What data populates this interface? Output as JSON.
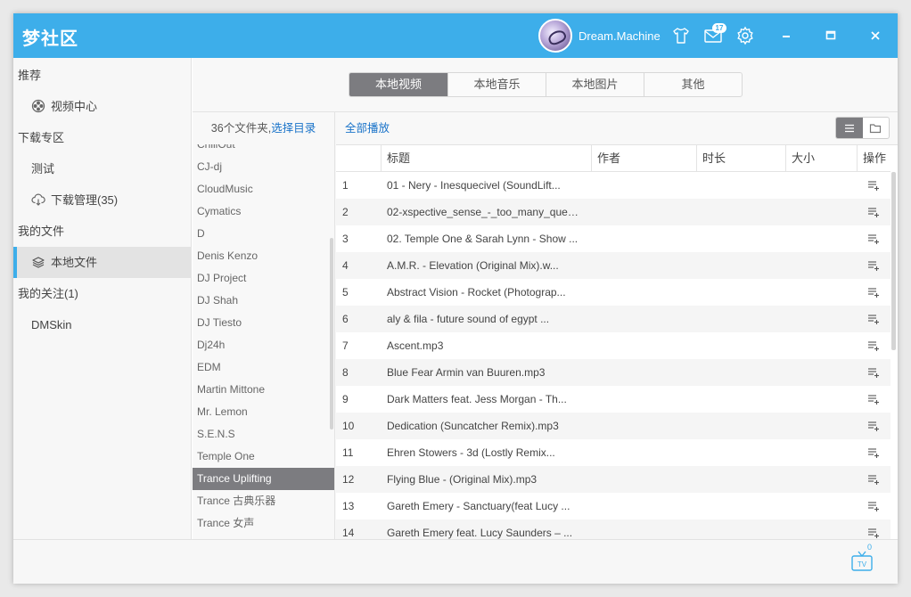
{
  "colors": {
    "accent": "#3daeea",
    "active_gray": "#7c7c80",
    "link": "#1a73c9"
  },
  "titlebar": {
    "app_title": "梦社区",
    "username": "Dream.Machine",
    "mail_badge": "17",
    "icons": [
      "shirt-icon",
      "mail-icon",
      "gear-icon",
      "minimize-icon",
      "maximize-icon",
      "close-icon"
    ]
  },
  "sidebar": {
    "recommend": "推荐",
    "video_center": "视频中心",
    "download_zone": "下载专区",
    "test": "测试",
    "download_manage": "下载管理(35)",
    "my_files": "我的文件",
    "local_files": "本地文件",
    "my_follow": "我的关注(1)",
    "dmskin": "DMSkin"
  },
  "tabs": [
    "本地视频",
    "本地音乐",
    "本地图片",
    "其他"
  ],
  "folders": {
    "count_text": "36个文件夹,",
    "choose_dir": "选择目录",
    "items": [
      "ChillOut",
      "CJ-dj",
      "CloudMusic",
      "Cymatics",
      "D",
      "Denis Kenzo",
      "DJ Project",
      "DJ Shah",
      "DJ Tiesto",
      "Dj24h",
      "EDM",
      "Martin Mittone",
      "Mr. Lemon",
      "S.E.N.S",
      "Temple One",
      "Trance Uplifting",
      "Trance 古典乐器",
      "Trance 女声"
    ],
    "selected": "Trance Uplifting"
  },
  "play_all": "全部播放",
  "table": {
    "headers": {
      "title": "标题",
      "author": "作者",
      "duration": "时长",
      "size": "大小",
      "action": "操作"
    },
    "rows": [
      {
        "n": "1",
        "title": "01 - Nery - Inesquecivel (SoundLift..."
      },
      {
        "n": "2",
        "title": "02-xspective_sense_-_too_many_quest..."
      },
      {
        "n": "3",
        "title": "02. Temple One & Sarah Lynn - Show ..."
      },
      {
        "n": "4",
        "title": "A.M.R. - Elevation (Original Mix).w..."
      },
      {
        "n": "5",
        "title": "Abstract Vision - Rocket (Photograp..."
      },
      {
        "n": "6",
        "title": "aly & fila - future sound of egypt ..."
      },
      {
        "n": "7",
        "title": "Ascent.mp3"
      },
      {
        "n": "8",
        "title": "Blue Fear Armin van Buuren.mp3"
      },
      {
        "n": "9",
        "title": "Dark Matters feat. Jess Morgan - Th..."
      },
      {
        "n": "10",
        "title": "Dedication (Suncatcher Remix).mp3"
      },
      {
        "n": "11",
        "title": "Ehren  Stowers - 3d  (Lostly  Remix..."
      },
      {
        "n": "12",
        "title": "Flying Blue -  (Original Mix).mp3"
      },
      {
        "n": "13",
        "title": "Gareth Emery - Sanctuary(feat Lucy ..."
      },
      {
        "n": "14",
        "title": "Gareth Emery feat. Lucy Saunders – ..."
      }
    ]
  },
  "footer": {
    "tv_label": "TV",
    "tv_count": "0"
  }
}
